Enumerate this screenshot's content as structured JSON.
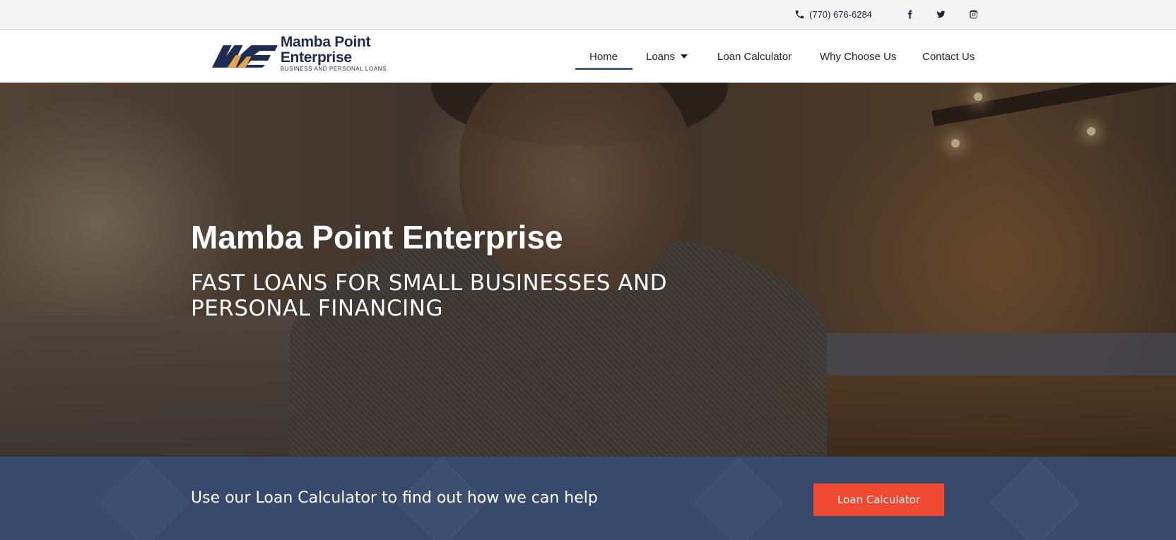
{
  "topbar": {
    "phone_icon": "phone-icon",
    "phone": "(770) 676-6284",
    "social": [
      {
        "name": "facebook-icon"
      },
      {
        "name": "twitter-icon"
      },
      {
        "name": "instagram-icon"
      }
    ]
  },
  "brand": {
    "name": "Mamba Point Enterprise",
    "tagline": "BUSINESS AND PERSONAL LOANS",
    "colors": {
      "navy": "#1f2c52",
      "gold": "#e5a54a"
    }
  },
  "nav": {
    "home": "Home",
    "loans": "Loans",
    "calculator": "Loan Calculator",
    "why": "Why Choose Us",
    "contact": "Contact Us",
    "active": "Home"
  },
  "hero": {
    "title": "Mamba Point Enterprise",
    "subtitle": "FAST LOANS FOR SMALL BUSINESSES AND PERSONAL FINANCING"
  },
  "cta": {
    "text": "Use our Loan Calculator to find out how we can help",
    "button": "Loan Calculator",
    "band_color": "#384a6c",
    "button_color": "#f04a33"
  }
}
